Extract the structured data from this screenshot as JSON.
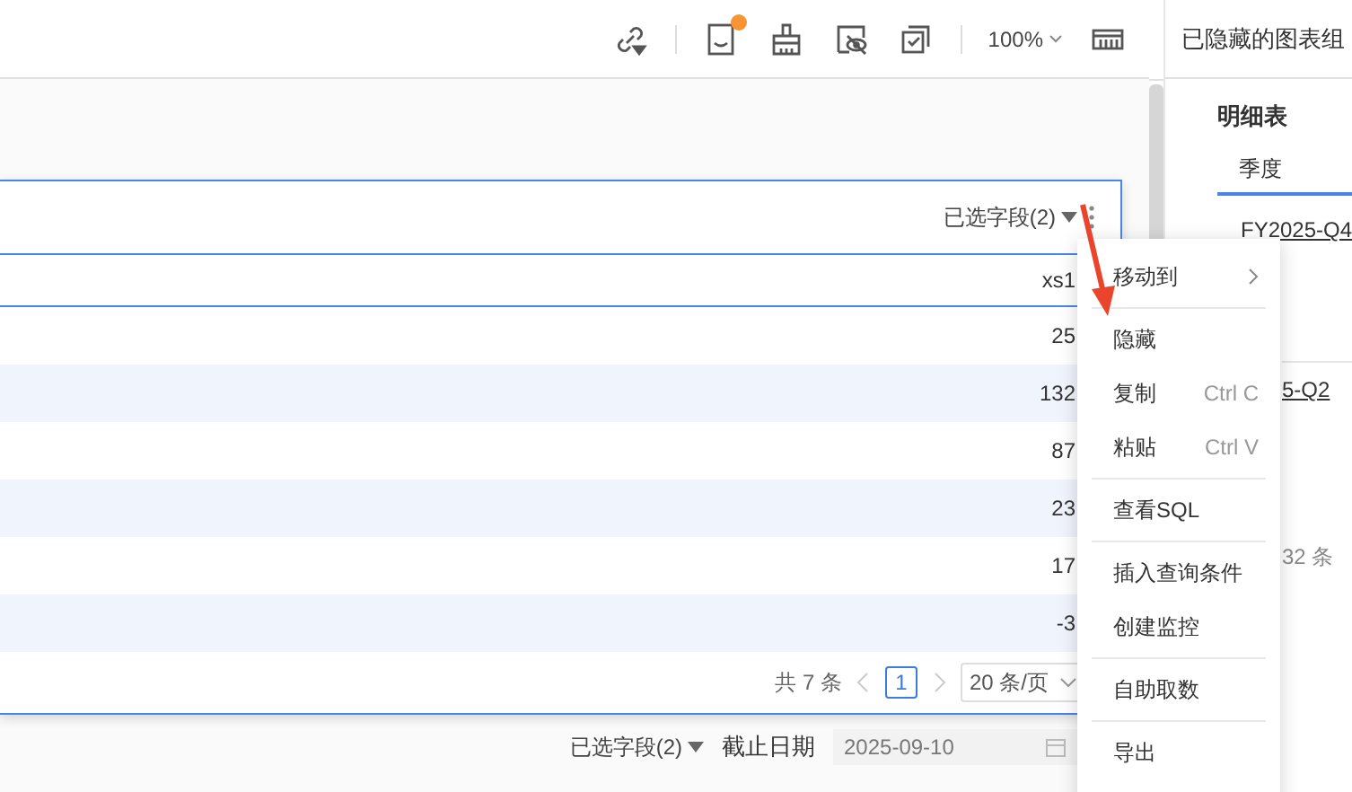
{
  "toolbar": {
    "notify_dot": true,
    "zoom": "100%"
  },
  "right_panel": {
    "title": "已隐藏的图表组",
    "section": "明细表",
    "tabs": [
      {
        "label": "季度",
        "selected": true
      }
    ],
    "items": [
      {
        "kind": "link",
        "text": "FY2025-Q4"
      },
      {
        "kind": "covered-link",
        "text": "5-Q2"
      },
      {
        "kind": "covered-note",
        "text": "32 条"
      }
    ]
  },
  "table": {
    "field_selector": "已选字段(2)",
    "columns": [
      "xs1"
    ],
    "rows": [
      [
        "25"
      ],
      [
        "132"
      ],
      [
        "87"
      ],
      [
        "23"
      ],
      [
        "17"
      ],
      [
        "-3"
      ]
    ],
    "pagination": {
      "total": "共 7 条",
      "pages": [
        {
          "label": "1",
          "selected": true
        }
      ],
      "page_size": "20 条/页"
    }
  },
  "filter_bar": {
    "field_selector": "已选字段(2)",
    "date_label": "截止日期",
    "date_value": "2025-09-10"
  },
  "context_menu": {
    "groups": [
      [
        {
          "kind": "submenu",
          "label": "移动到"
        }
      ],
      [
        {
          "kind": "item",
          "label": "隐藏"
        },
        {
          "kind": "item",
          "label": "复制",
          "shortcut": "Ctrl C"
        },
        {
          "kind": "item",
          "label": "粘贴",
          "shortcut": "Ctrl V"
        }
      ],
      [
        {
          "kind": "item",
          "label": "查看SQL"
        }
      ],
      [
        {
          "kind": "item",
          "label": "插入查询条件"
        },
        {
          "kind": "item",
          "label": "创建监控"
        }
      ],
      [
        {
          "kind": "item",
          "label": "自助取数"
        }
      ],
      [
        {
          "kind": "item",
          "label": "导出"
        }
      ]
    ]
  }
}
